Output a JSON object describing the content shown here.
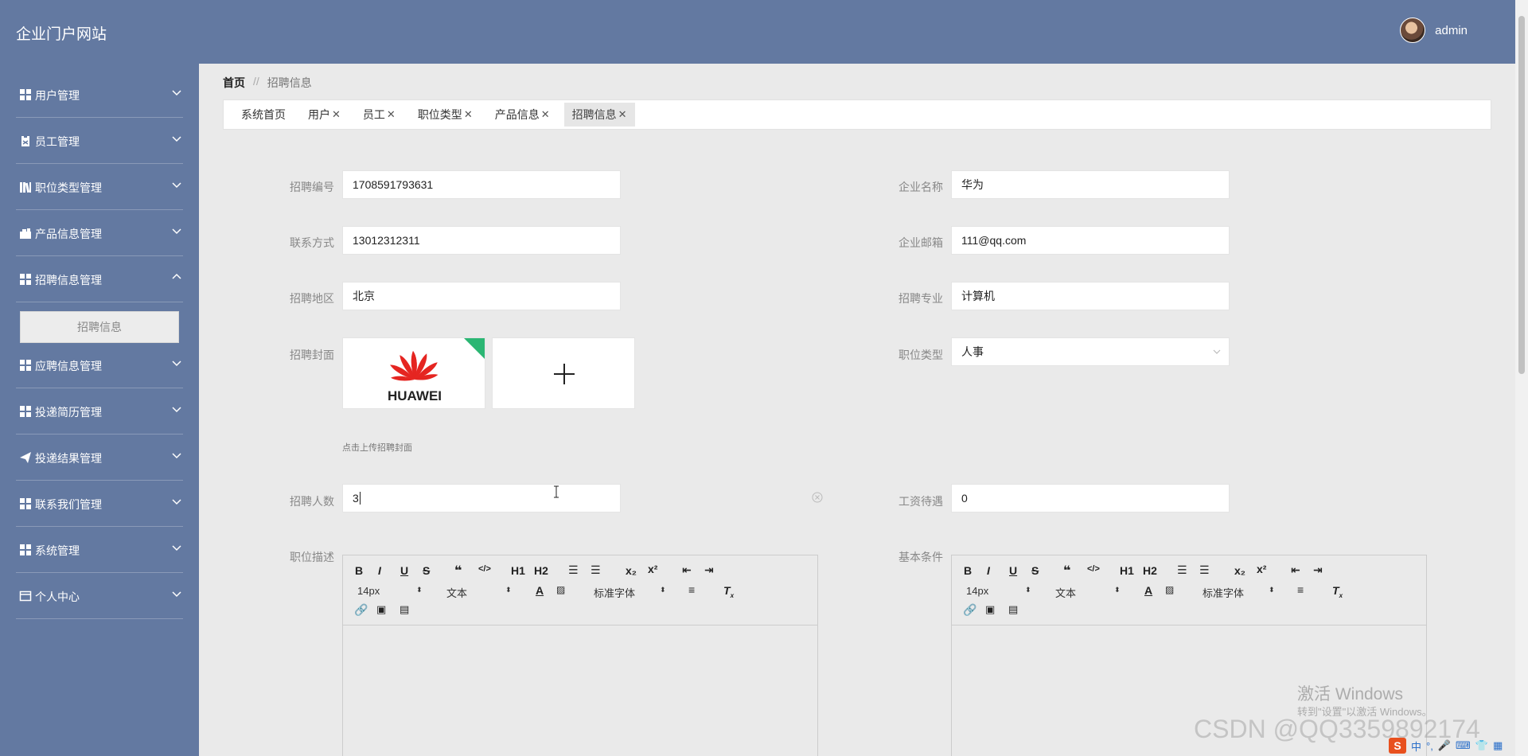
{
  "header": {
    "site_title": "企业门户网站",
    "user_name": "admin"
  },
  "sidebar": {
    "items": [
      {
        "label": "用户管理",
        "icon": "grid-icon"
      },
      {
        "label": "员工管理",
        "icon": "clipboard-icon"
      },
      {
        "label": "职位类型管理",
        "icon": "books-icon"
      },
      {
        "label": "产品信息管理",
        "icon": "briefcase-icon"
      },
      {
        "label": "招聘信息管理",
        "icon": "grid-icon",
        "expanded": true
      },
      {
        "label": "应聘信息管理",
        "icon": "grid-icon"
      },
      {
        "label": "投递简历管理",
        "icon": "grid-icon"
      },
      {
        "label": "投递结果管理",
        "icon": "send-icon"
      },
      {
        "label": "联系我们管理",
        "icon": "grid-icon"
      },
      {
        "label": "系统管理",
        "icon": "grid-icon"
      },
      {
        "label": "个人中心",
        "icon": "window-icon"
      }
    ],
    "submenu": {
      "label": "招聘信息"
    }
  },
  "breadcrumb": {
    "home": "首页",
    "separator": "//",
    "current": "招聘信息"
  },
  "tabs": [
    {
      "label": "系统首页",
      "closable": false
    },
    {
      "label": "用户",
      "closable": true
    },
    {
      "label": "员工",
      "closable": true
    },
    {
      "label": "职位类型",
      "closable": true
    },
    {
      "label": "产品信息",
      "closable": true
    },
    {
      "label": "招聘信息",
      "closable": true,
      "active": true
    }
  ],
  "form": {
    "recruit_no": {
      "label": "招聘编号",
      "value": "1708591793631"
    },
    "company_name": {
      "label": "企业名称",
      "value": "华为"
    },
    "contact": {
      "label": "联系方式",
      "value": "13012312311"
    },
    "company_email": {
      "label": "企业邮箱",
      "value": "111@qq.com"
    },
    "region": {
      "label": "招聘地区",
      "value": "北京"
    },
    "major": {
      "label": "招聘专业",
      "value": "计算机"
    },
    "cover": {
      "label": "招聘封面",
      "hint": "点击上传招聘封面",
      "image_text": "HUAWEI"
    },
    "position_type": {
      "label": "职位类型",
      "value": "人事"
    },
    "headcount": {
      "label": "招聘人数",
      "value": "3"
    },
    "salary": {
      "label": "工资待遇",
      "value": "0"
    },
    "description": {
      "label": "职位描述"
    },
    "requirements": {
      "label": "基本条件"
    }
  },
  "editor_toolbar": {
    "font_size": "14px",
    "format": "文本",
    "font_family": "标准字体",
    "h1": "H1",
    "h2": "H2",
    "bold": "B",
    "italic": "I",
    "underline": "U",
    "strike": "S"
  },
  "watermarks": {
    "windows_title": "激活 Windows",
    "windows_sub": "转到\"设置\"以激活 Windows。",
    "csdn": "CSDN @QQ3359892174"
  },
  "tray": {
    "ime": "中"
  },
  "colors": {
    "sidebar": "#6379a1",
    "header": "#6379a1",
    "huawei_red": "#e52521",
    "corner_badge": "#2bb673"
  }
}
